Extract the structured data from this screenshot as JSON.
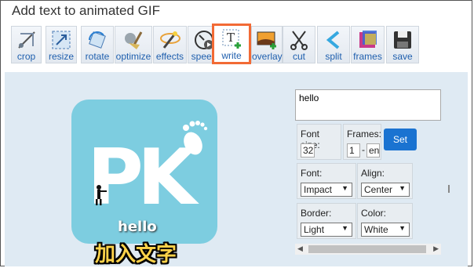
{
  "title": "Add text to animated GIF",
  "toolbar": [
    {
      "label": "crop",
      "icon": "crop-icon"
    },
    {
      "label": "resize",
      "icon": "resize-icon"
    },
    {
      "label": "rotate",
      "icon": "rotate-icon"
    },
    {
      "label": "optimize",
      "icon": "broom-icon"
    },
    {
      "label": "effects",
      "icon": "magic-wand-icon"
    },
    {
      "label": "speed",
      "icon": "speedometer-icon"
    },
    {
      "label": "write",
      "icon": "text-add-icon",
      "active": true
    },
    {
      "label": "overlay",
      "icon": "overlay-image-icon"
    },
    {
      "label": "cut",
      "icon": "scissors-icon"
    },
    {
      "label": "split",
      "icon": "split-icon"
    },
    {
      "label": "frames",
      "icon": "frames-icon"
    },
    {
      "label": "save",
      "icon": "floppy-disk-icon"
    }
  ],
  "preview": {
    "overlay_text": "hello",
    "overlay_text_cn": "加入文字",
    "logo_letters": "PK"
  },
  "form": {
    "text_value": "hello",
    "font_size_label": "Font size:",
    "font_size_value": "32",
    "frames_label": "Frames:",
    "frames_start": "1",
    "frames_sep": "-",
    "frames_end": "end",
    "set_button": "Set",
    "font_label": "Font:",
    "font_value": "Impact",
    "align_label": "Align:",
    "align_value": "Center",
    "border_label": "Border:",
    "border_value": "Light",
    "color_label": "Color:",
    "color_value": "White"
  },
  "colors": {
    "accent": "#f26a35",
    "set_button": "#1a73d1",
    "logo_bg": "#7dcde0",
    "panel_bg": "#dfeaf3"
  }
}
